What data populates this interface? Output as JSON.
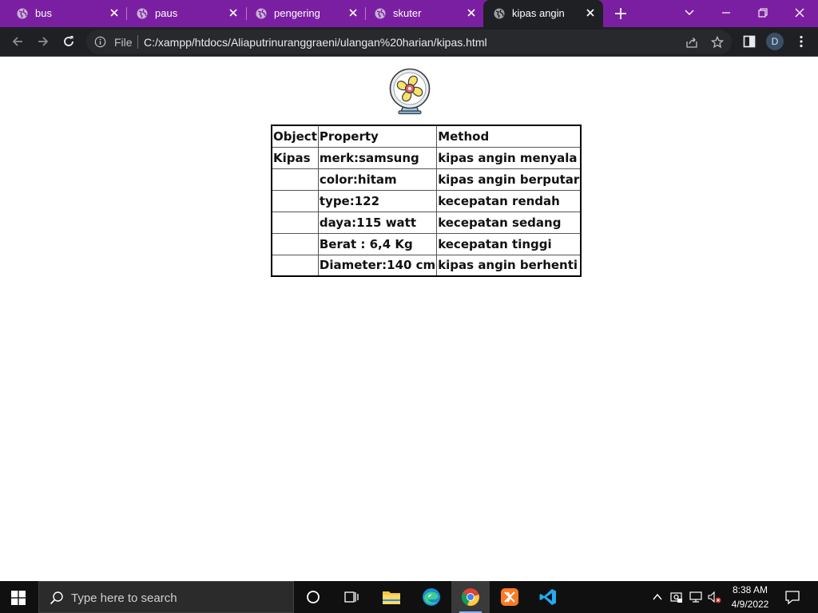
{
  "browser": {
    "tabs": [
      {
        "title": "bus",
        "active": false
      },
      {
        "title": "paus",
        "active": false
      },
      {
        "title": "pengering",
        "active": false
      },
      {
        "title": "skuter",
        "active": false
      },
      {
        "title": "kipas angin",
        "active": true
      }
    ],
    "address": {
      "scheme_label": "File",
      "url": "C:/xampp/htdocs/Aliaputrinuranggraeni/ulangan%20harian/kipas.html"
    },
    "profile_initial": "D",
    "accent_color": "#7b1fa2"
  },
  "page": {
    "image": {
      "icon": "fan-icon"
    },
    "table": {
      "headers": [
        "Object",
        "Property",
        "Method"
      ],
      "rows": [
        [
          "Kipas",
          "merk:samsung",
          "kipas angin menyala"
        ],
        [
          "",
          "color:hitam",
          "kipas angin berputar"
        ],
        [
          "",
          "type:122",
          "kecepatan rendah"
        ],
        [
          "",
          "daya:115 watt",
          "kecepatan sedang"
        ],
        [
          "",
          "Berat : 6,4 Kg",
          "kecepatan tinggi"
        ],
        [
          "",
          "Diameter:140 cm",
          "kipas angin berhenti"
        ]
      ]
    }
  },
  "taskbar": {
    "search_placeholder": "Type here to search",
    "apps": [
      "task-view",
      "file-explorer",
      "edge",
      "chrome",
      "xampp",
      "vscode"
    ],
    "active_app": "chrome",
    "clock": {
      "time": "8:38 AM",
      "date": "4/9/2022"
    }
  }
}
